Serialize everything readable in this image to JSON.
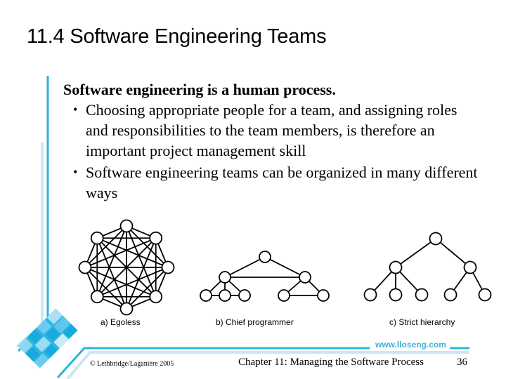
{
  "slide": {
    "title": "11.4 Software Engineering Teams",
    "lead": "Software engineering is a human process.",
    "bullets": [
      {
        "text": "Choosing appropriate people for a team, and assigning roles and responsibilities to the team members, is therefore an important project management skill"
      },
      {
        "text": "Software engineering teams can be organized in many different ways"
      }
    ],
    "bullet_glyph": "•"
  },
  "diagrams": [
    {
      "caption": "a) Egoless",
      "structure": "complete-graph",
      "nodes": 8
    },
    {
      "caption": "b) Chief programmer",
      "structure": "tree-with-peer-links",
      "nodes": 8
    },
    {
      "caption": "c) Strict hierarchy",
      "structure": "tree",
      "nodes": 8
    }
  ],
  "footer": {
    "copyright": "© Lethbridge/Laganière 2005",
    "chapter": "Chapter 11: Managing the Software Process",
    "page_number": "36",
    "url": "www.lloseng.com"
  },
  "colors": {
    "accent": "#29b5dc",
    "accent_light": "#c9e7f3",
    "accent_mid": "#7fd0ea"
  }
}
